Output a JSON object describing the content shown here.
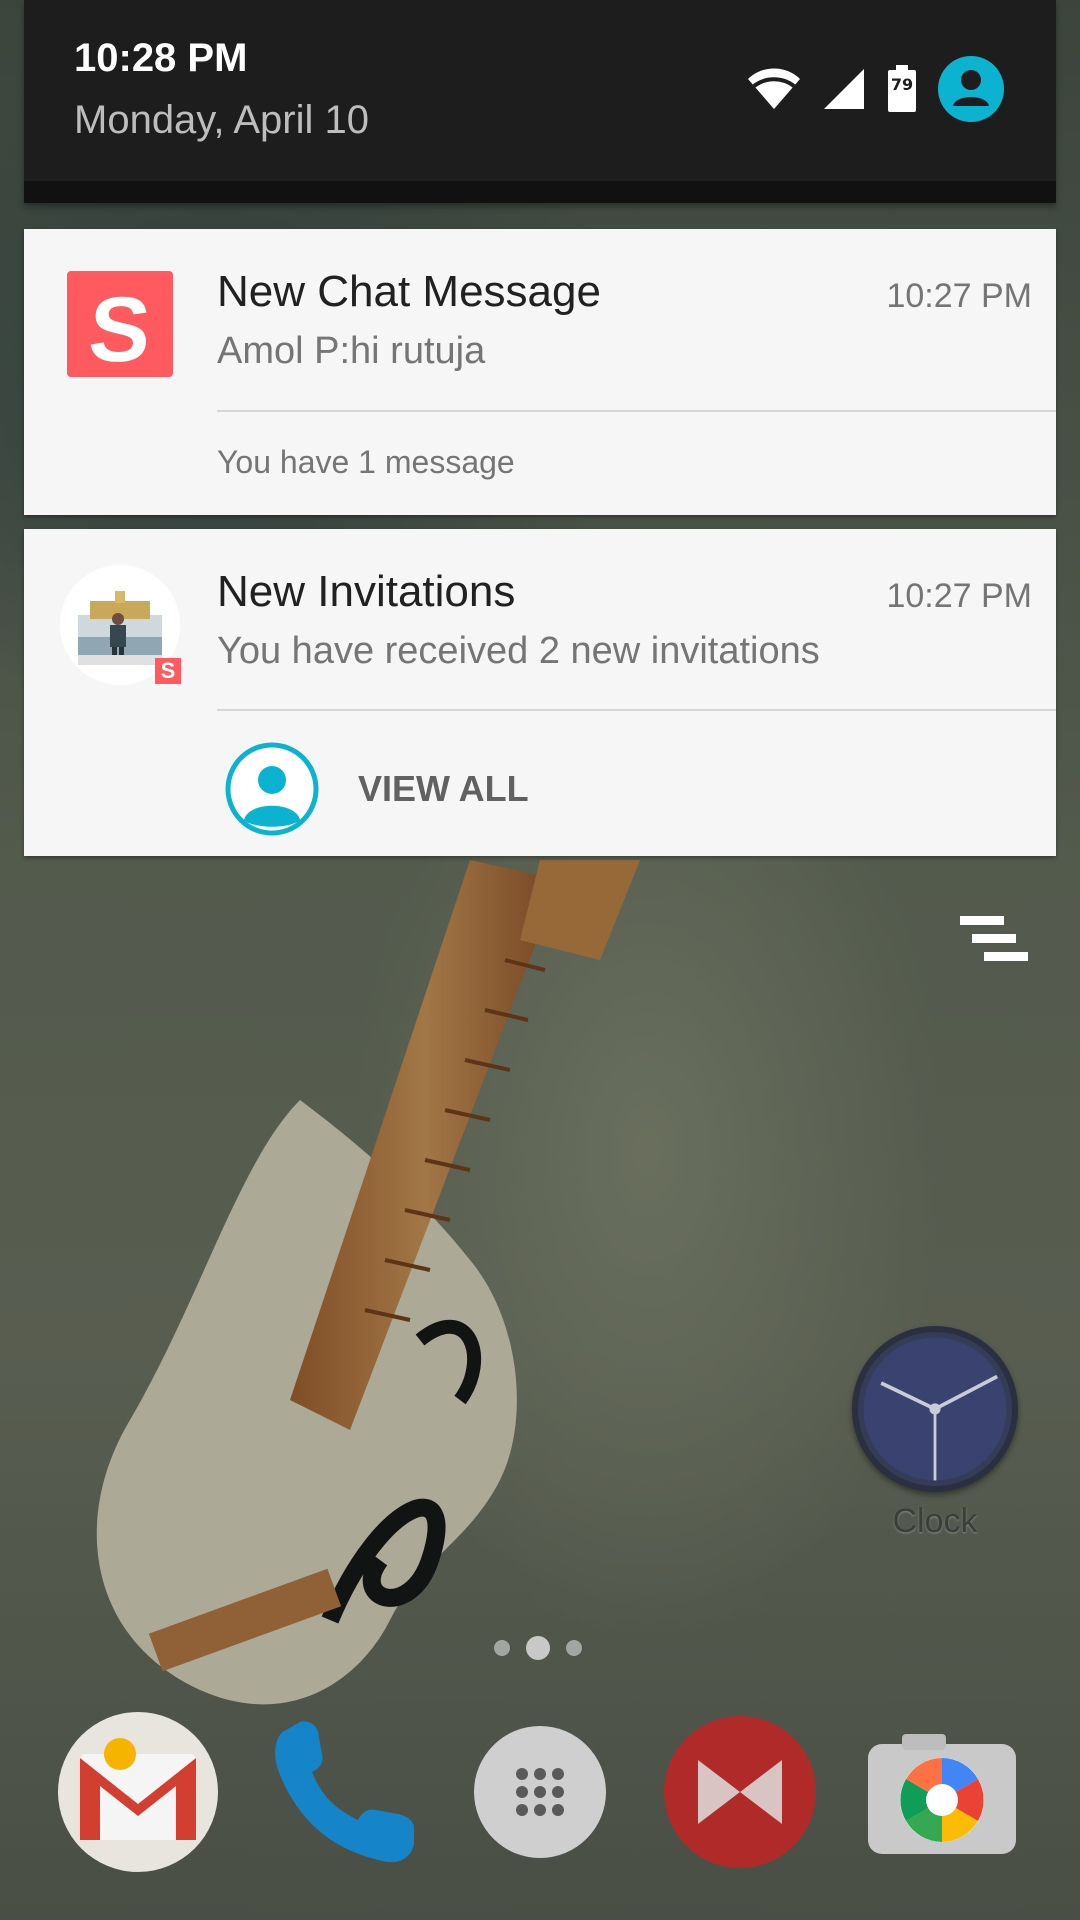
{
  "status_header": {
    "time": "10:28 PM",
    "date": "Monday, April 10",
    "battery_percent": "79",
    "icons": [
      "wifi-icon",
      "signal-icon",
      "battery-icon",
      "user-account-icon"
    ],
    "accent_color": "#0cb3d1"
  },
  "notifications": [
    {
      "app_icon": "app-logo-icon",
      "app_logo_letter": "S",
      "title": "New Chat Message",
      "time": "10:27 PM",
      "text": "Amol P:hi rutuja",
      "footer": "You have 1 message",
      "brand_color": "#ff5a5f"
    },
    {
      "app_icon": "contact-photo",
      "badge_letter": "S",
      "title": "New Invitations",
      "time": "10:27 PM",
      "text": "You have received 2 new invitations",
      "action": {
        "icon": "person-icon",
        "label": "VIEW ALL"
      }
    }
  ],
  "clear_all_icon": "clear-all-icon",
  "home_screen": {
    "clock_label": "Clock",
    "page_count": 3,
    "active_page": 2,
    "dock": [
      "gmail-icon",
      "phone-icon",
      "app-drawer-icon",
      "mx-app-icon",
      "camera-icon"
    ]
  }
}
